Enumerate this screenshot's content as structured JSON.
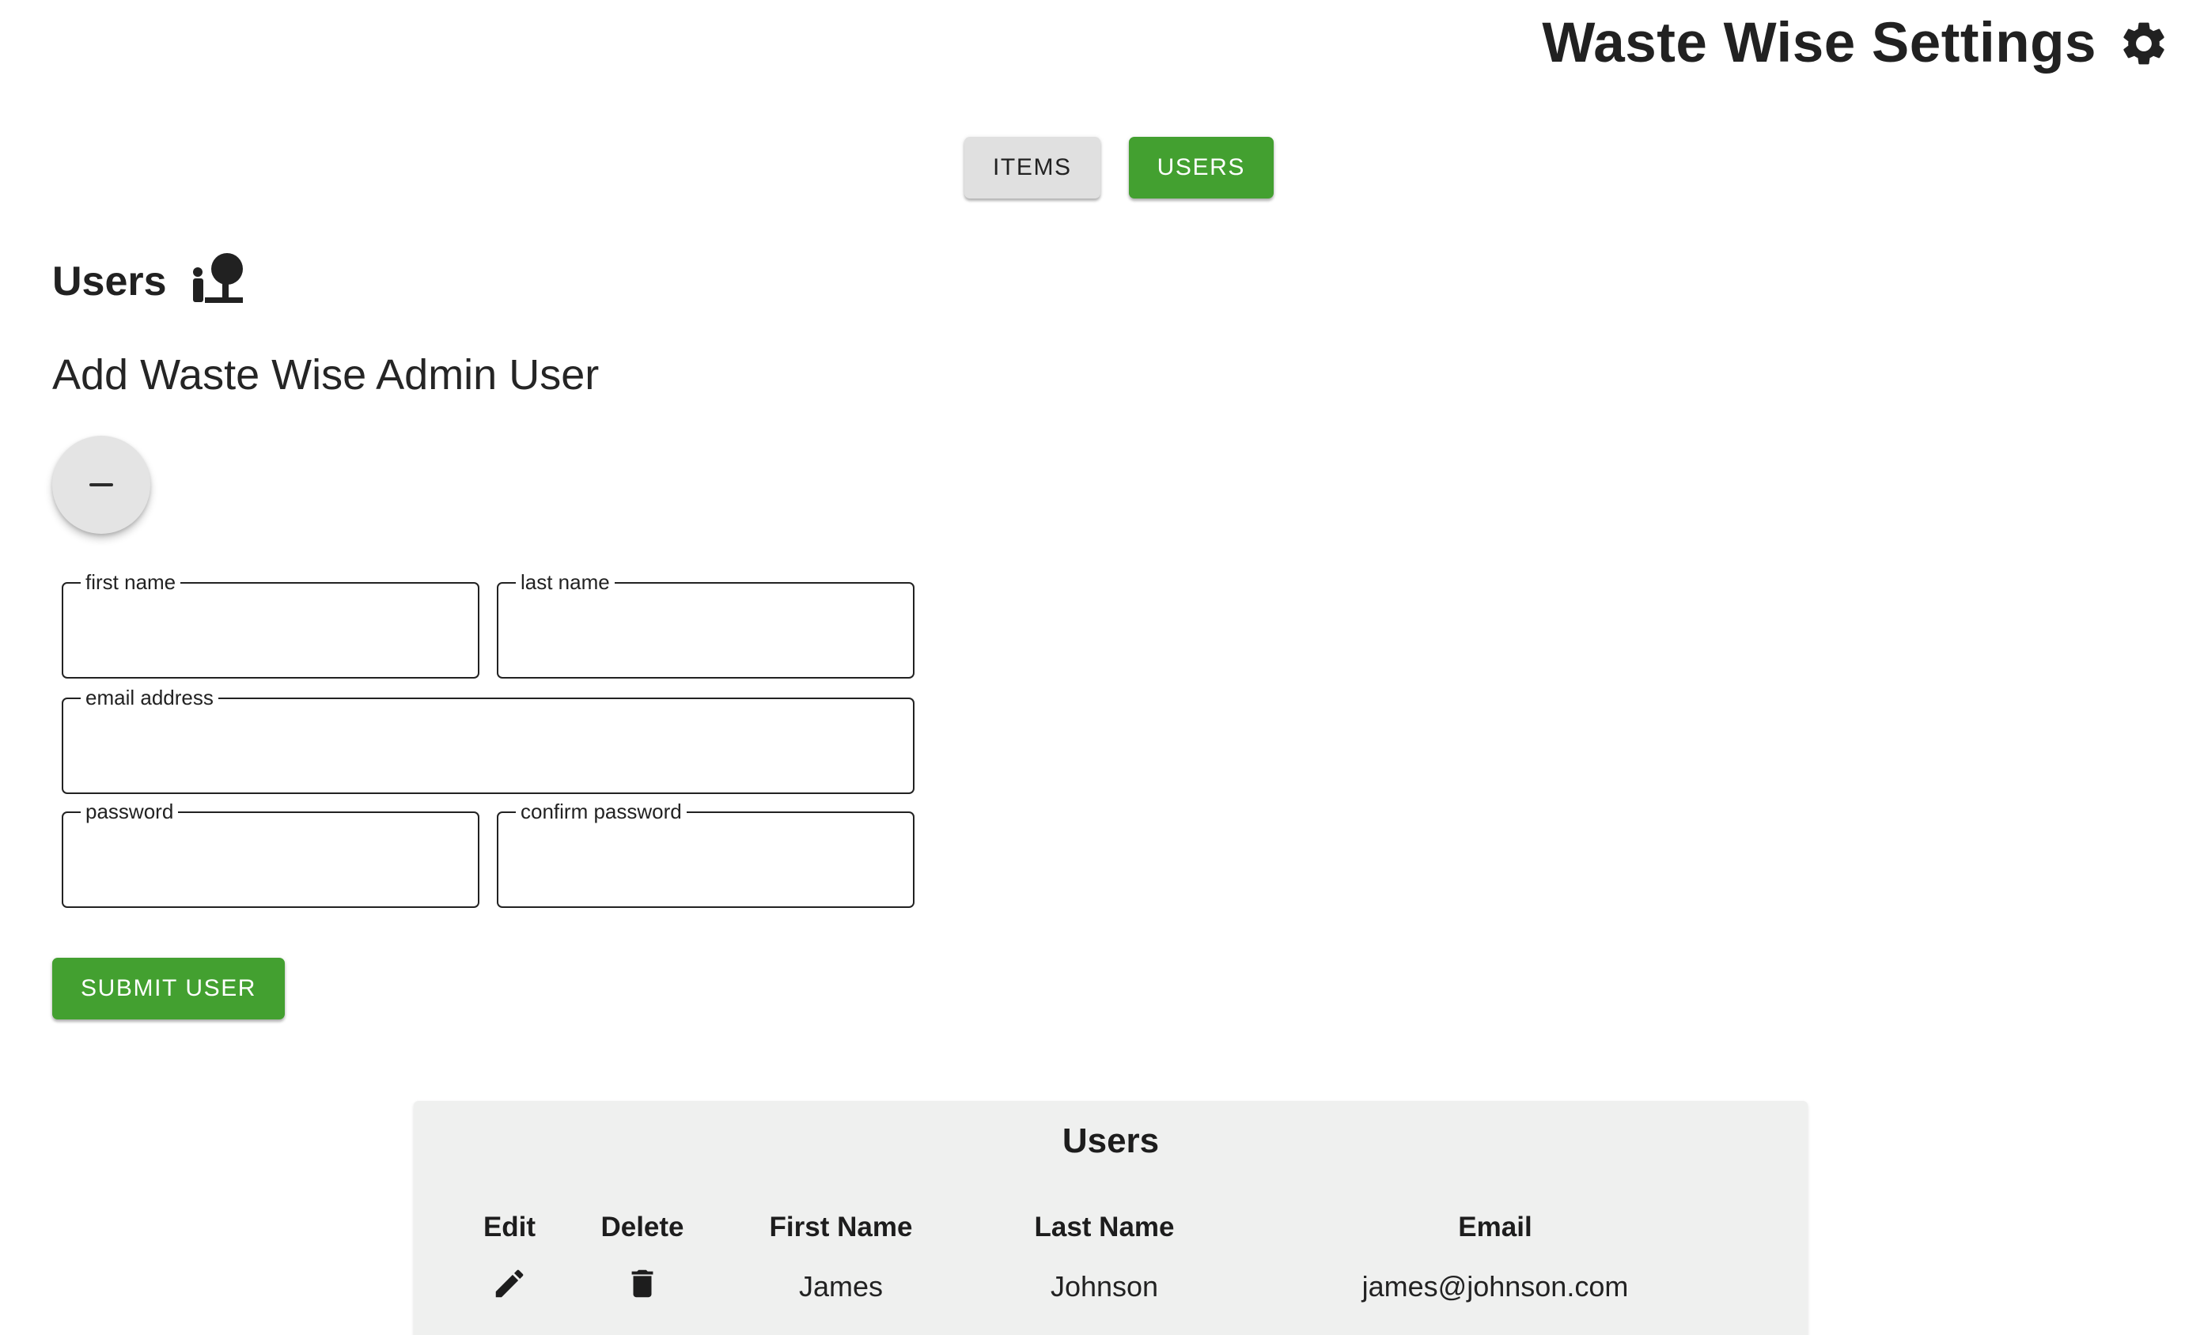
{
  "header": {
    "title": "Waste Wise Settings",
    "icon": "gear-icon"
  },
  "tabs": [
    {
      "label": "ITEMS",
      "active": false
    },
    {
      "label": "USERS",
      "active": true
    }
  ],
  "section": {
    "heading": "Users",
    "heading_icon": "user-icon",
    "subheading": "Add Waste Wise Admin User"
  },
  "toggle": {
    "icon": "minus-icon"
  },
  "form": {
    "first_name": {
      "label": "first name",
      "value": ""
    },
    "last_name": {
      "label": "last name",
      "value": ""
    },
    "email": {
      "label": "email address",
      "value": ""
    },
    "password": {
      "label": "password",
      "value": ""
    },
    "confirm_password": {
      "label": "confirm password",
      "value": ""
    },
    "submit_label": "SUBMIT USER"
  },
  "users_table": {
    "title": "Users",
    "columns": [
      "Edit",
      "Delete",
      "First Name",
      "Last Name",
      "Email"
    ],
    "rows": [
      {
        "edit_icon": "pencil-icon",
        "delete_icon": "trash-icon",
        "first_name": "James",
        "last_name": "Johnson",
        "email": "james@johnson.com"
      }
    ]
  },
  "colors": {
    "accent": "#43a030",
    "tab_inactive": "#e0e0e0",
    "panel_bg": "#eff0ef"
  }
}
